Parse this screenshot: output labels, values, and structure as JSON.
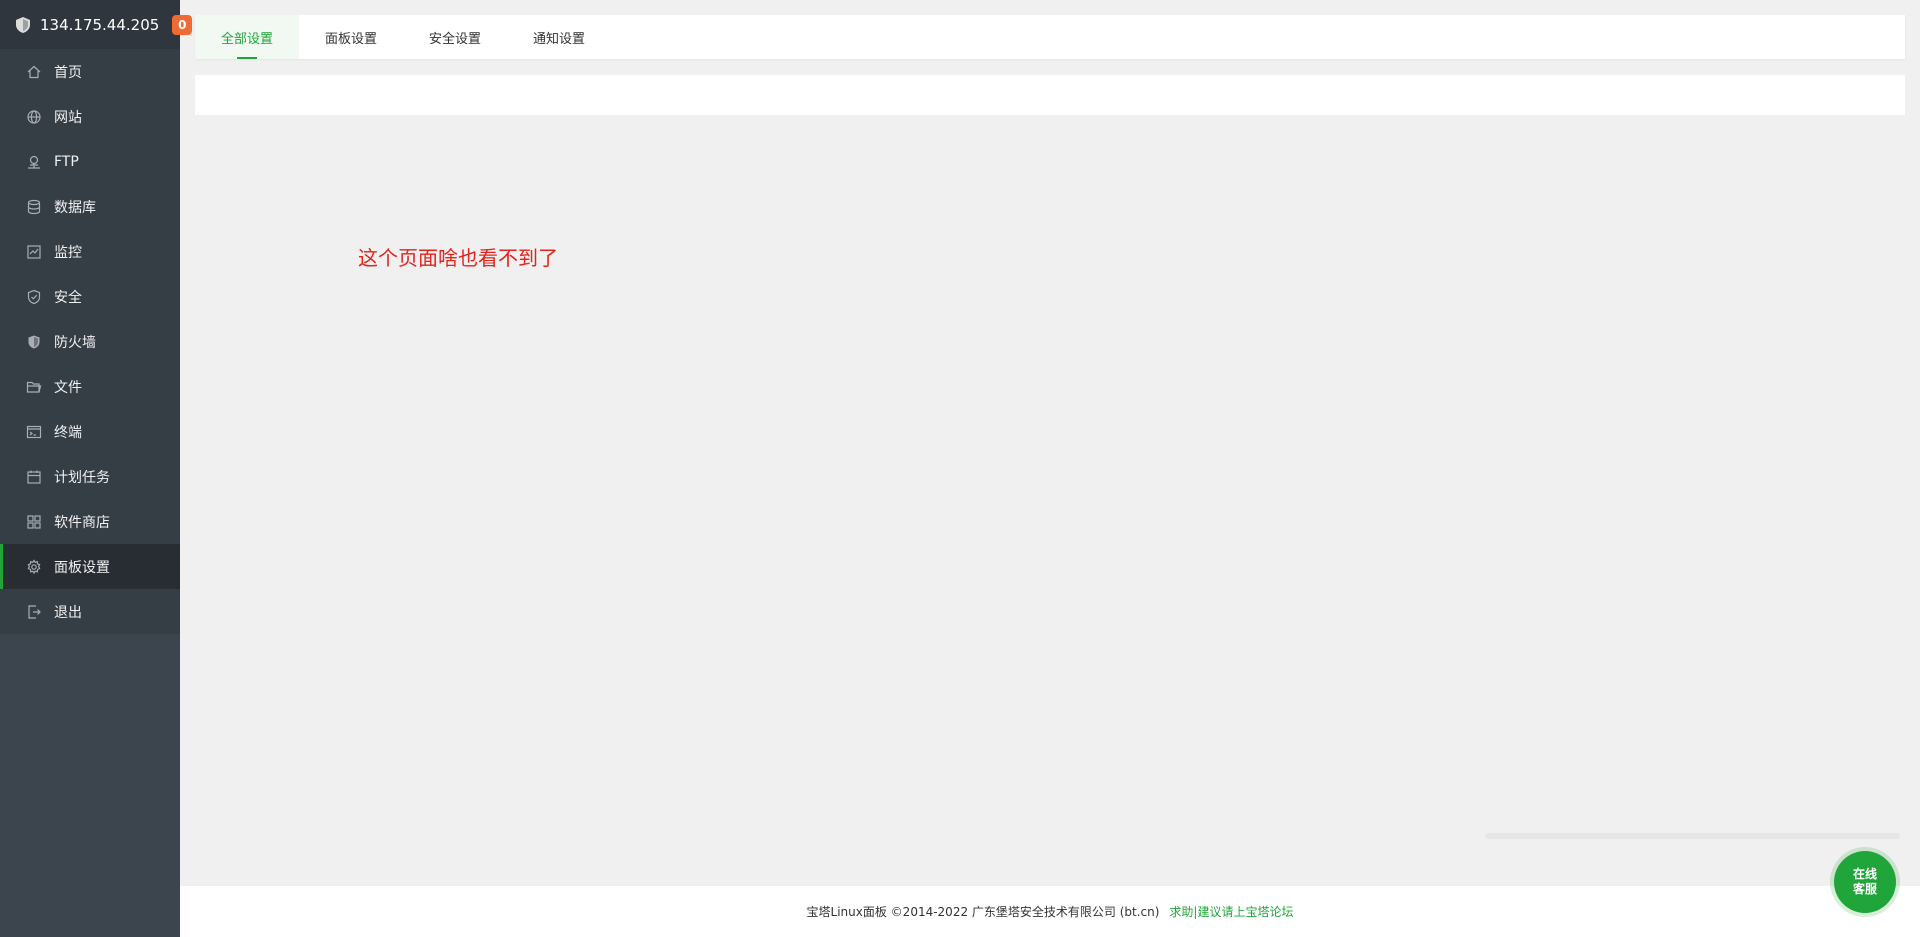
{
  "sidebar": {
    "server_ip": "134.175.44.205",
    "badge_count": "0",
    "items": [
      {
        "label": "首页",
        "icon": "home-icon"
      },
      {
        "label": "网站",
        "icon": "globe-icon"
      },
      {
        "label": "FTP",
        "icon": "ftp-icon"
      },
      {
        "label": "数据库",
        "icon": "database-icon"
      },
      {
        "label": "监控",
        "icon": "monitor-icon"
      },
      {
        "label": "安全",
        "icon": "shield-check-icon"
      },
      {
        "label": "防火墙",
        "icon": "firewall-shield-icon"
      },
      {
        "label": "文件",
        "icon": "folder-icon"
      },
      {
        "label": "终端",
        "icon": "terminal-icon"
      },
      {
        "label": "计划任务",
        "icon": "calendar-icon"
      },
      {
        "label": "软件商店",
        "icon": "grid-apps-icon"
      },
      {
        "label": "面板设置",
        "icon": "gear-icon",
        "active": true
      },
      {
        "label": "退出",
        "icon": "logout-icon"
      }
    ]
  },
  "tabs": [
    {
      "label": "全部设置",
      "active": true
    },
    {
      "label": "面板设置"
    },
    {
      "label": "安全设置"
    },
    {
      "label": "通知设置"
    }
  ],
  "main": {
    "notice": "这个页面啥也看不到了"
  },
  "footer": {
    "copyright": "宝塔Linux面板 ©2014-2022 广东堡塔安全技术有限公司 (bt.cn)",
    "help_link": "求助|建议请上宝塔论坛"
  },
  "service_button": {
    "line1": "在线",
    "line2": "客服"
  },
  "colors": {
    "accent": "#20a53a",
    "badge": "#f06a33",
    "notice": "#e2231a",
    "sidebar_bg": "#3c444d"
  }
}
